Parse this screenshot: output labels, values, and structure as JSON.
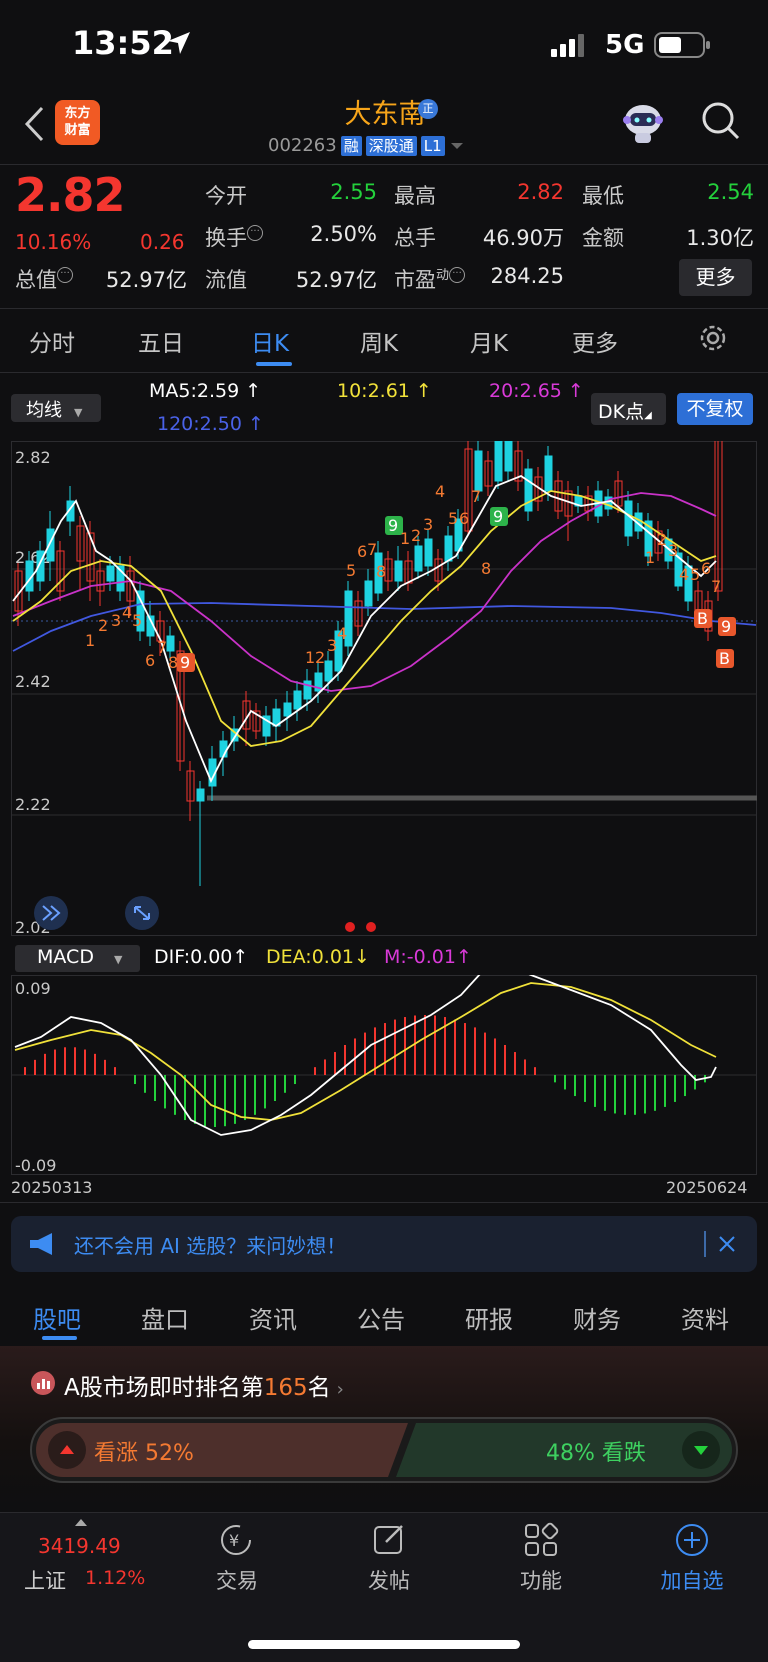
{
  "status_bar": {
    "time": "13:52",
    "network": "5G"
  },
  "header": {
    "logo_line1": "东方",
    "logo_line2": "财富",
    "stock_name": "大东南",
    "badge": "正",
    "code": "002263",
    "tags": [
      "融",
      "深股通",
      "L1"
    ]
  },
  "quote": {
    "price": "2.82",
    "change_pct": "10.16%",
    "change_amt": "0.26",
    "fields": [
      {
        "label": "今开",
        "value": "2.55",
        "color": "green"
      },
      {
        "label": "最高",
        "value": "2.82",
        "color": "red"
      },
      {
        "label": "最低",
        "value": "2.54",
        "color": "green"
      },
      {
        "label": "换手",
        "value": "2.50%",
        "color": "white"
      },
      {
        "label": "总手",
        "value": "46.90万",
        "color": "white"
      },
      {
        "label": "金额",
        "value": "1.30亿",
        "color": "white"
      },
      {
        "label": "总值",
        "value": "52.97亿",
        "color": "white"
      },
      {
        "label": "流值",
        "value": "52.97亿",
        "color": "white"
      },
      {
        "label": "市盈",
        "label_sup": "动",
        "value": "284.25",
        "color": "white"
      }
    ],
    "more": "更多"
  },
  "k_tabs": [
    {
      "label": "分时"
    },
    {
      "label": "五日"
    },
    {
      "label": "日K",
      "active": true
    },
    {
      "label": "周K"
    },
    {
      "label": "月K"
    },
    {
      "label": "更多"
    }
  ],
  "ma": {
    "select": "均线",
    "ma5": "MA5:2.59",
    "ma10": "10:2.61",
    "ma20": "20:2.65",
    "ma120": "120:2.50",
    "dk": "DK点",
    "fq": "不复权"
  },
  "chart_data": [
    {
      "type": "candlestick",
      "title": "日K",
      "y_ticks": [
        "2.82",
        "2.62",
        "2.42",
        "2.22",
        "2.02"
      ],
      "ylim": [
        2.02,
        2.82
      ],
      "series": [
        {
          "name": "MA5"
        },
        {
          "name": "10"
        },
        {
          "name": "20"
        },
        {
          "name": "120"
        }
      ],
      "markers": [
        "1",
        "2",
        "3",
        "4",
        "5",
        "6",
        "7",
        "8",
        "9",
        "9",
        "1",
        "2",
        "3",
        "4",
        "5",
        "6",
        "7",
        "8",
        "9",
        "4",
        "5",
        "6",
        "7",
        "8",
        "1",
        "2",
        "3",
        "4",
        "5",
        "6",
        "7",
        "9",
        "B",
        "B"
      ]
    },
    {
      "type": "bar",
      "title": "MACD",
      "y_ticks": [
        "0.09",
        "-0.09"
      ],
      "ylim": [
        -0.09,
        0.09
      ],
      "x_range": [
        "20250313",
        "20250624"
      ],
      "series": [
        {
          "name": "DIF",
          "last": 0.0
        },
        {
          "name": "DEA",
          "last": 0.01
        },
        {
          "name": "M",
          "last": -0.01
        }
      ]
    }
  ],
  "macd": {
    "select": "MACD",
    "dif": "DIF:0.00",
    "dea": "DEA:0.01",
    "m": "M:-0.01",
    "date_start": "20250313",
    "date_end": "20250624"
  },
  "ai_banner": {
    "text": "还不会用 AI 选股？来问妙想！"
  },
  "section_tabs": [
    {
      "label": "股吧",
      "active": true
    },
    {
      "label": "盘口"
    },
    {
      "label": "资讯"
    },
    {
      "label": "公告"
    },
    {
      "label": "研报"
    },
    {
      "label": "财务"
    },
    {
      "label": "资料"
    }
  ],
  "ranking": {
    "prefix": "A股市场即时排名第",
    "rank": "165",
    "suffix": "名"
  },
  "vote": {
    "up_label": "看涨",
    "up_pct": "52%",
    "down_label": "看跌",
    "down_pct": "48%"
  },
  "bottom_nav": {
    "index_value": "3419.49",
    "index_name": "上证",
    "index_change": "1.12%",
    "items": [
      {
        "label": "交易"
      },
      {
        "label": "发帖"
      },
      {
        "label": "功能"
      },
      {
        "label": "加自选"
      }
    ]
  },
  "colors": {
    "up": "#f4362f",
    "down": "#24d13c",
    "accent": "#2d6fd6",
    "name": "#f7a51a"
  }
}
